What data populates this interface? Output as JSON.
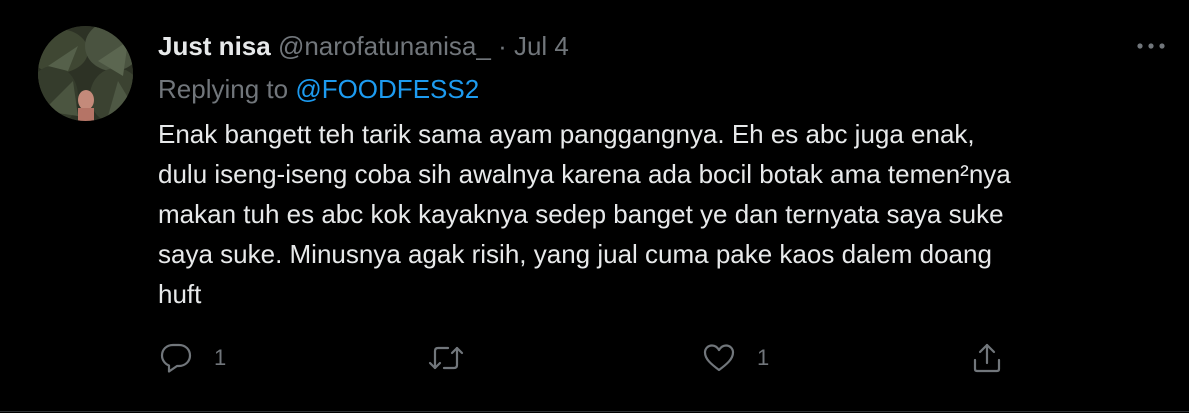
{
  "tweet": {
    "author_name": "Just nisa",
    "handle": "@narofatunanisa_",
    "separator": "·",
    "date": "Jul 4",
    "replying_prefix": "Replying to",
    "replying_to": "@FOODFESS2",
    "text_lines": [
      "Enak bangett teh tarik sama ayam panggangnya. Eh es abc juga enak,",
      "dulu iseng-iseng coba sih awalnya karena ada bocil botak ama temen²nya",
      "makan tuh es abc kok kayaknya sedep banget ye dan ternyata saya suke",
      "saya suke. Minusnya agak risih, yang jual cuma pake kaos dalem doang",
      "huft"
    ],
    "actions": {
      "reply_count": "1",
      "retweet_count": "",
      "like_count": "1"
    },
    "icons": [
      "more-icon",
      "reply-icon",
      "retweet-icon",
      "like-icon",
      "share-icon"
    ]
  },
  "colors": {
    "background": "#000000",
    "text_primary": "#e7e9ea",
    "text_secondary": "#71767b",
    "accent": "#1d9bf0"
  }
}
